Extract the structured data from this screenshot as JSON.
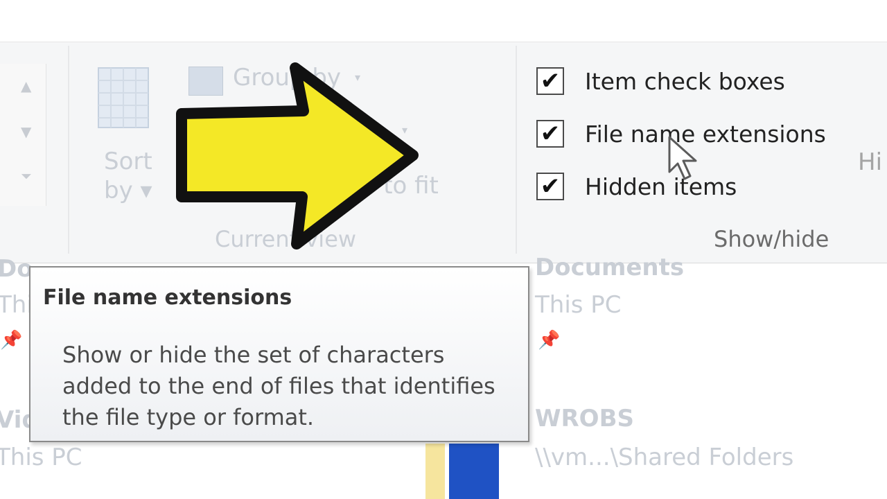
{
  "ribbon": {
    "layout_group": {
      "scroll_up": "▲",
      "scroll_down": "▼",
      "scroll_more": "⏷"
    },
    "current_view": {
      "sort_by_line1": "Sort",
      "sort_by_line2": "by ▾",
      "group_by": "Group by",
      "group_by_arrow": "▾",
      "add_columns_arrow": "▾",
      "size_columns_partial": "mns to fit",
      "group_label": "Current view"
    },
    "show_hide": {
      "items": [
        {
          "label": "Item check boxes",
          "checked": true
        },
        {
          "label": "File name extensions",
          "checked": true
        },
        {
          "label": "Hidden items",
          "checked": true
        }
      ],
      "group_label": "Show/hide",
      "hide_selected_partial": "Hi"
    }
  },
  "quick_access": {
    "left_partial": {
      "row1_name": "Do",
      "row1_sub": "Thi",
      "row2_name": "Vid",
      "row2_sub": "This PC"
    },
    "documents": {
      "name": "Documents",
      "location": "This PC"
    },
    "network": {
      "name": "WROBS",
      "location": "\\\\vm...\\Shared Folders"
    }
  },
  "tooltip": {
    "title": "File name extensions",
    "body": "Show or hide the set of characters added to the end of files that identifies the file type or format."
  },
  "icons": {
    "checkmark": "✔",
    "pin": "📌"
  },
  "colors": {
    "arrow_fill": "#f4e826",
    "arrow_outline": "#111111",
    "thumbnail_blue": "#1f52c4"
  }
}
